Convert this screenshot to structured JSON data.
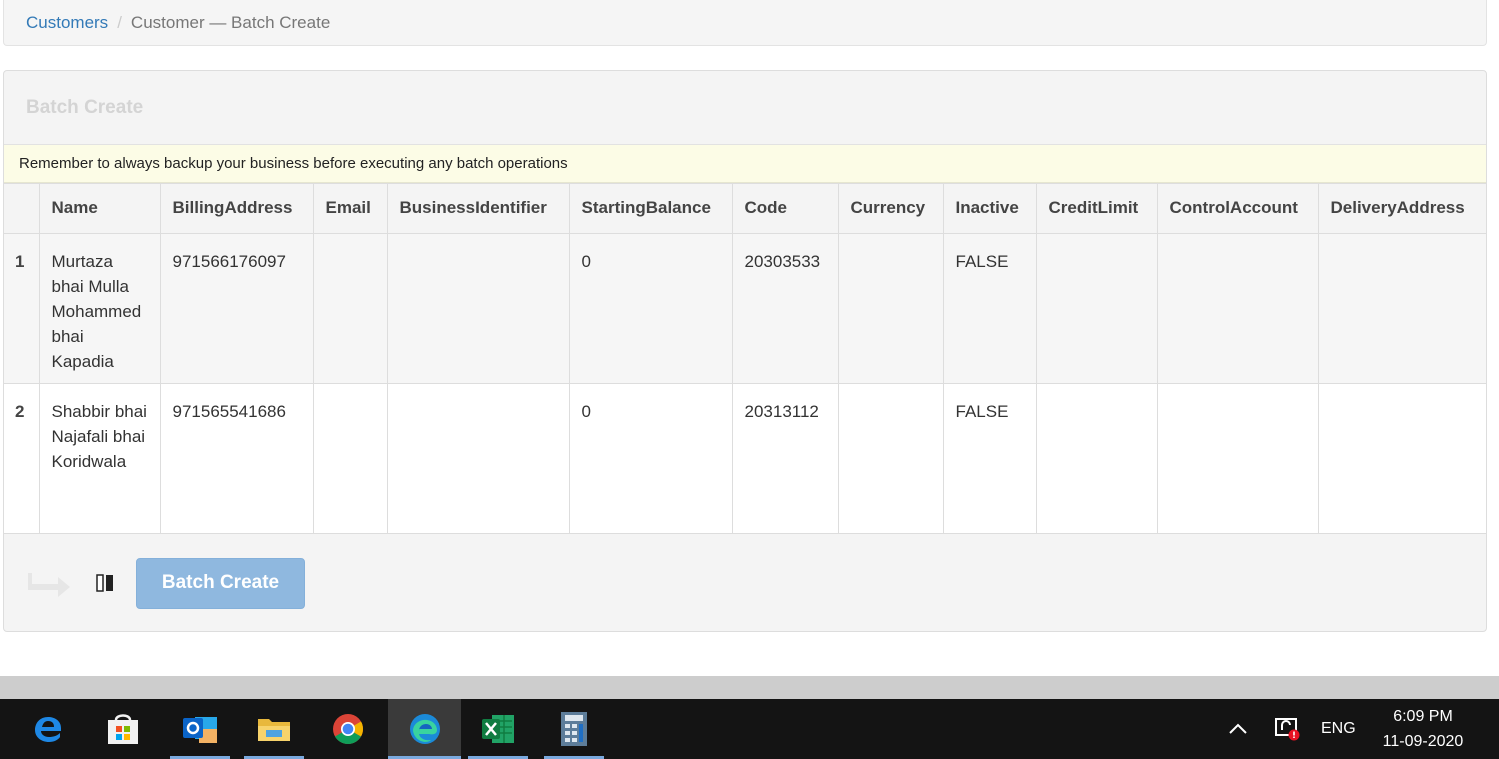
{
  "breadcrumb": {
    "root": "Customers",
    "separator": "/",
    "current": "Customer — Batch Create"
  },
  "panel": {
    "title": "Batch Create",
    "notice": "Remember to always backup your business before executing any batch operations"
  },
  "table": {
    "headers": [
      "",
      "Name",
      "BillingAddress",
      "Email",
      "BusinessIdentifier",
      "StartingBalance",
      "Code",
      "Currency",
      "Inactive",
      "CreditLimit",
      "ControlAccount",
      "DeliveryAddress"
    ],
    "rows": [
      {
        "index": "1",
        "name": "Murtaza bhai Mulla Mohammed bhai Kapadia",
        "billing_address": "971566176097",
        "email": "",
        "business_identifier": "",
        "starting_balance": "0",
        "code": "20303533",
        "currency": "",
        "inactive": "FALSE",
        "credit_limit": "",
        "control_account": "",
        "delivery_address": ""
      },
      {
        "index": "2",
        "name": "Shabbir bhai Najafali bhai Koridwala",
        "billing_address": "971565541686",
        "email": "",
        "business_identifier": "",
        "starting_balance": "0",
        "code": "20313112",
        "currency": "",
        "inactive": "FALSE",
        "credit_limit": "",
        "control_account": "",
        "delivery_address": ""
      }
    ]
  },
  "footer": {
    "arrow_icon": "return-arrow-icon",
    "columns_icon": "columns-icon",
    "button_label": "Batch Create"
  },
  "taskbar": {
    "apps": [
      "edge-legacy-icon",
      "store-icon",
      "outlook-icon",
      "file-explorer-icon",
      "chrome-icon",
      "edge-icon",
      "excel-icon",
      "calculator-icon"
    ],
    "language": "ENG",
    "time": "6:09 PM",
    "date": "11-09-2020"
  },
  "colors": {
    "link": "#337ab7",
    "button": "#8fb8df",
    "notice_bg": "#fcfce6",
    "taskbar": "#141414"
  }
}
